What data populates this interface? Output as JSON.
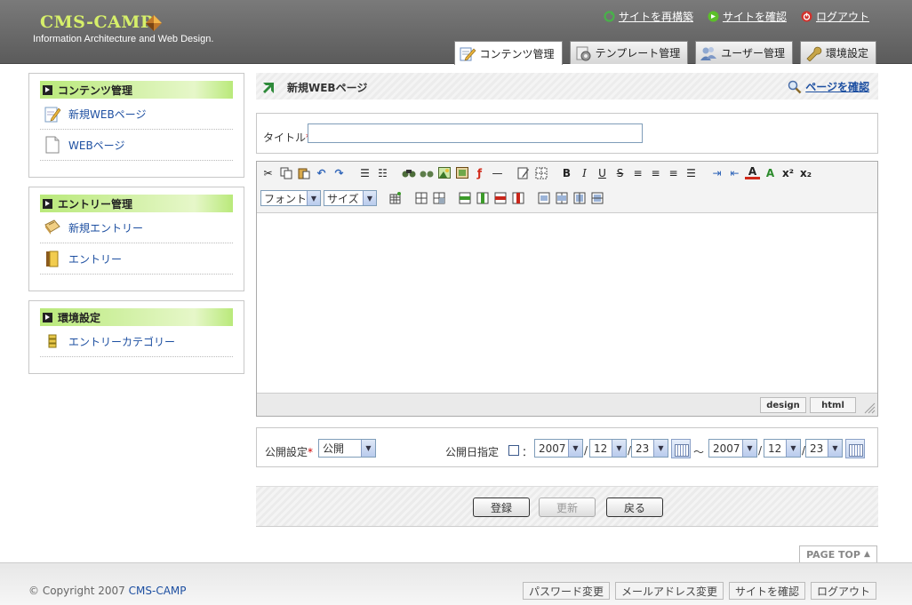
{
  "header": {
    "logo_title": "CMS-CAMP",
    "logo_subtitle": "Information Architecture and Web Design.",
    "top_links": [
      {
        "label": "サイトを再構築",
        "icon": "refresh-icon",
        "color": "#49b14a"
      },
      {
        "label": "サイトを確認",
        "icon": "arrow-right-circle-icon",
        "color": "#5cbf2a"
      },
      {
        "label": "ログアウト",
        "icon": "power-icon",
        "color": "#d2322d"
      }
    ],
    "tabs": [
      {
        "label": "コンテンツ管理",
        "icon": "content-edit-icon",
        "active": true
      },
      {
        "label": "テンプレート管理",
        "icon": "template-gear-icon",
        "active": false
      },
      {
        "label": "ユーザー管理",
        "icon": "users-icon",
        "active": false
      },
      {
        "label": "環境設定",
        "icon": "wrench-icon",
        "active": false
      }
    ]
  },
  "sidebar": {
    "sections": [
      {
        "title": "コンテンツ管理",
        "items": [
          {
            "label": "新規WEBページ",
            "icon": "new-page-icon"
          },
          {
            "label": "WEBページ",
            "icon": "page-icon"
          }
        ]
      },
      {
        "title": "エントリー管理",
        "items": [
          {
            "label": "新規エントリー",
            "icon": "new-entry-icon"
          },
          {
            "label": "エントリー",
            "icon": "entry-folder-icon"
          }
        ]
      },
      {
        "title": "環境設定",
        "items": [
          {
            "label": "エントリーカテゴリー",
            "icon": "category-icon"
          }
        ]
      }
    ]
  },
  "main": {
    "page_title": "新規WEBページ",
    "confirm_link": "ページを確認",
    "title_field": {
      "label": "タイトル",
      "required_mark": "*",
      "value": ""
    },
    "editor": {
      "font_select": "フォント",
      "size_select": "サイズ",
      "bold": "B",
      "italic": "I",
      "underline": "U",
      "strike": "S",
      "mode_design": "design",
      "mode_html": "html"
    },
    "publish": {
      "label": "公開設定",
      "required_mark": "*",
      "value": "公開",
      "date_label": "公開日指定",
      "colon": "：",
      "from": {
        "year": "2007",
        "month": "12",
        "day": "23"
      },
      "to": {
        "year": "2007",
        "month": "12",
        "day": "23"
      },
      "tilde": "～",
      "slash": "/"
    },
    "buttons": {
      "register": "登録",
      "update": "更新",
      "back": "戻る"
    }
  },
  "page_top": "PAGE TOP",
  "footer": {
    "copyright_prefix": "© Copyright 2007",
    "copyright_link": "CMS-CAMP",
    "links": [
      "パスワード変更",
      "メールアドレス変更",
      "サイトを確認",
      "ログアウト"
    ]
  }
}
